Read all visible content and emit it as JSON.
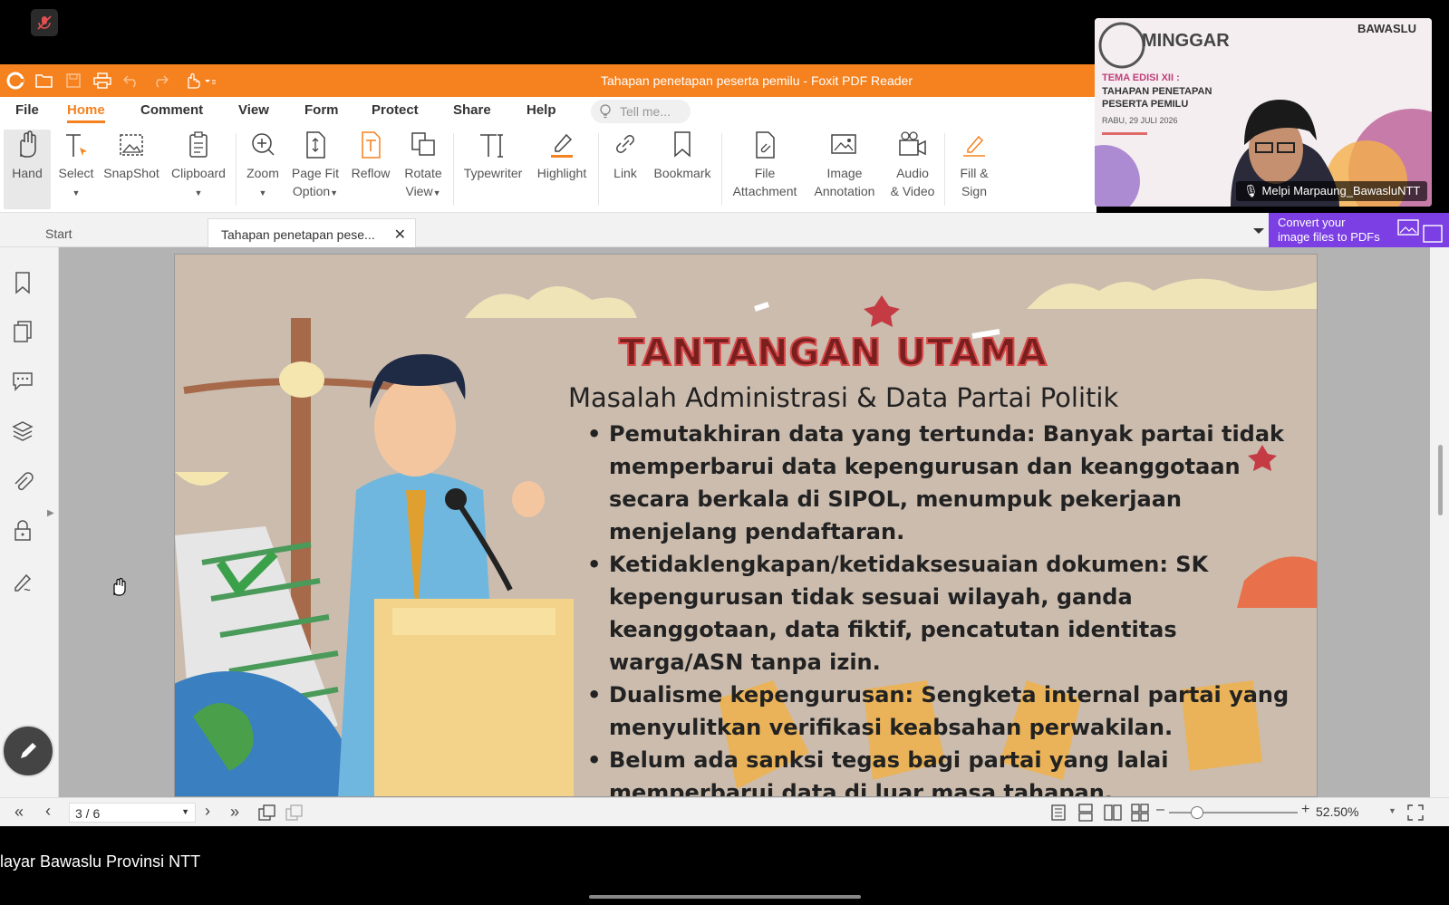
{
  "app": {
    "title": "Tahapan penetapan peserta pemilu - Foxit PDF Reader",
    "accent": "#f5821f"
  },
  "menu": {
    "items": [
      "File",
      "Home",
      "Comment",
      "View",
      "Form",
      "Protect",
      "Share",
      "Help"
    ],
    "tell_me": "Tell me..."
  },
  "ribbon": {
    "hand": "Hand",
    "select": "Select",
    "snapshot": "SnapShot",
    "clipboard": "Clipboard",
    "zoom": "Zoom",
    "page_fit_1": "Page Fit",
    "page_fit_2": "Option",
    "reflow": "Reflow",
    "rotate_1": "Rotate",
    "rotate_2": "View",
    "typewriter": "Typewriter",
    "highlight": "Highlight",
    "link": "Link",
    "bookmark": "Bookmark",
    "file_att_1": "File",
    "file_att_2": "Attachment",
    "image_ann_1": "Image",
    "image_ann_2": "Annotation",
    "audio_1": "Audio",
    "audio_2": "& Video",
    "fill_1": "Fill &",
    "fill_2": "Sign"
  },
  "tabs": {
    "start": "Start",
    "doc": "Tahapan penetapan pese..."
  },
  "ad": {
    "line1": "Convert your",
    "line2": "image files to PDFs"
  },
  "slide": {
    "title": "TANTANGAN UTAMA",
    "subtitle": "Masalah Administrasi & Data Partai Politik",
    "bullets": [
      "Pemutakhiran data yang tertunda: Banyak partai tidak memperbarui data kepengurusan dan keanggotaan secara berkala di SIPOL, menumpuk pekerjaan menjelang pendaftaran.",
      "Ketidaklengkapan/ketidaksesuaian dokumen: SK kepengurusan tidak sesuai wilayah, ganda keanggotaan, data fiktif, pencatutan identitas warga/ASN tanpa izin.",
      "Dualisme kepengurusan: Sengketa internal partai yang menyulitkan verifikasi keabsahan perwakilan.",
      "Belum ada sanksi tegas bagi partai yang lalai memperbarui data di luar masa tahapan."
    ]
  },
  "status": {
    "page": "3 / 6",
    "zoom": "52.50%",
    "zoom_level": 0.22
  },
  "video": {
    "brand": "MINGGAR",
    "org": "BAWASLU",
    "theme_1": "TEMA EDISI XII :",
    "theme_2": "TAHAPAN PENETAPAN",
    "theme_3": "PESERTA PEMILU",
    "date": "RABU, 29 JULI 2026",
    "presenter": "Melpi Marpaung_BawasluNTT"
  },
  "caption": "layar Bawaslu Provinsi NTT"
}
